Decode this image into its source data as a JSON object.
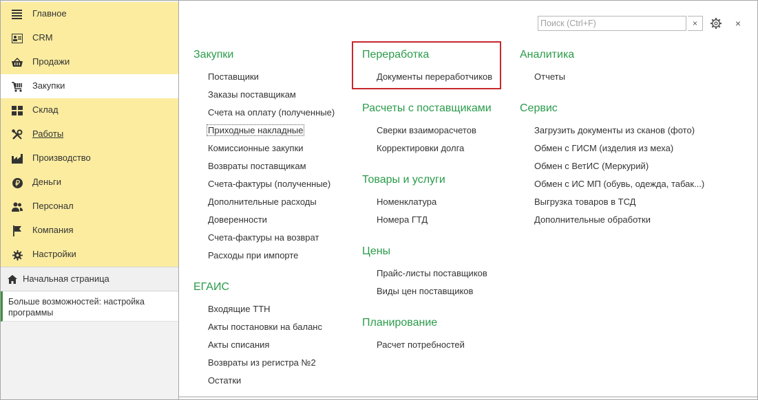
{
  "sidebar": {
    "items": [
      {
        "label": "Главное",
        "icon": "menu-icon"
      },
      {
        "label": "CRM",
        "icon": "contact-card-icon"
      },
      {
        "label": "Продажи",
        "icon": "basket-icon"
      },
      {
        "label": "Закупки",
        "icon": "cart-icon",
        "active": true
      },
      {
        "label": "Склад",
        "icon": "warehouse-grid-icon"
      },
      {
        "label": "Работы",
        "icon": "tools-icon"
      },
      {
        "label": "Производство",
        "icon": "factory-icon"
      },
      {
        "label": "Деньги",
        "icon": "ruble-icon"
      },
      {
        "label": "Персонал",
        "icon": "people-icon"
      },
      {
        "label": "Компания",
        "icon": "flag-icon"
      },
      {
        "label": "Настройки",
        "icon": "gear-icon"
      }
    ],
    "home": {
      "label": "Начальная страница",
      "icon": "home-icon"
    },
    "more": {
      "label": "Больше возможностей: настройка программы"
    }
  },
  "search": {
    "placeholder": "Поиск (Ctrl+F)",
    "value": "",
    "clear": "×"
  },
  "window": {
    "close": "×"
  },
  "columns": [
    {
      "sections": [
        {
          "title": "Закупки",
          "links": [
            "Поставщики",
            "Заказы поставщикам",
            "Счета на оплату (полученные)",
            "Приходные накладные",
            "Комиссионные закупки",
            "Возвраты поставщикам",
            "Счета-фактуры (полученные)",
            "Дополнительные расходы",
            "Доверенности",
            "Счета-фактуры на возврат",
            "Расходы при импорте"
          ]
        },
        {
          "title": "ЕГАИС",
          "links": [
            "Входящие ТТН",
            "Акты постановки на баланс",
            "Акты списания",
            "Возвраты из регистра №2",
            "Остатки"
          ]
        }
      ]
    },
    {
      "sections": [
        {
          "title": "Переработка",
          "links": [
            "Документы переработчиков"
          ]
        },
        {
          "title": "Расчеты с поставщиками",
          "links": [
            "Сверки взаиморасчетов",
            "Корректировки долга"
          ]
        },
        {
          "title": "Товары и услуги",
          "links": [
            "Номенклатура",
            "Номера ГТД"
          ]
        },
        {
          "title": "Цены",
          "links": [
            "Прайс-листы поставщиков",
            "Виды цен поставщиков"
          ]
        },
        {
          "title": "Планирование",
          "links": [
            "Расчет потребностей"
          ]
        }
      ]
    },
    {
      "sections": [
        {
          "title": "Аналитика",
          "links": [
            "Отчеты"
          ]
        },
        {
          "title": "Сервис",
          "links": [
            "Загрузить документы из сканов (фото)",
            "Обмен с ГИСМ (изделия из меха)",
            "Обмен с ВетИС (Меркурий)",
            "Обмен с ИС МП (обувь, одежда, табак...)",
            "Выгрузка товаров в ТСД",
            "Дополнительные обработки"
          ]
        }
      ]
    }
  ],
  "colors": {
    "accent_green": "#2a9b4a",
    "nav_yellow": "#fbec9f",
    "highlight_red": "#c8262b"
  }
}
